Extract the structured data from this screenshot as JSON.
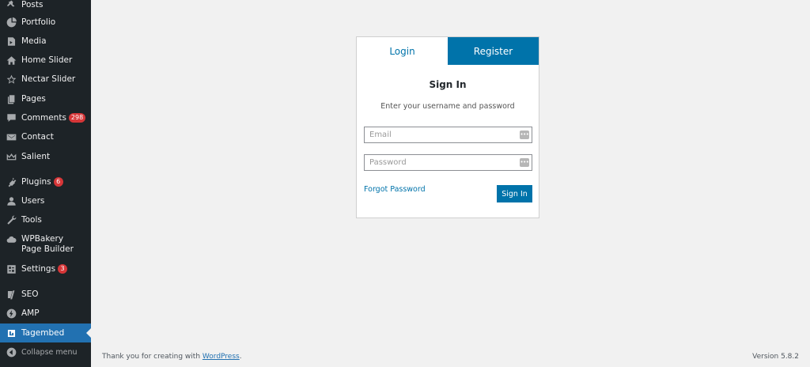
{
  "sidebar": {
    "items": [
      {
        "label": "Posts",
        "icon": "pin-icon"
      },
      {
        "label": "Portfolio",
        "icon": "portfolio-icon"
      },
      {
        "label": "Media",
        "icon": "media-icon"
      },
      {
        "label": "Home Slider",
        "icon": "home-icon"
      },
      {
        "label": "Nectar Slider",
        "icon": "star-icon"
      },
      {
        "label": "Pages",
        "icon": "pages-icon"
      },
      {
        "label": "Comments",
        "icon": "comment-icon",
        "badge": "298"
      },
      {
        "label": "Contact",
        "icon": "mail-icon"
      },
      {
        "label": "Salient",
        "icon": "crown-icon"
      },
      {
        "label": "Plugins",
        "icon": "plugin-icon",
        "badge": "6"
      },
      {
        "label": "Users",
        "icon": "user-icon"
      },
      {
        "label": "Tools",
        "icon": "wrench-icon"
      },
      {
        "label": "WPBakery Page Builder",
        "icon": "cloud-icon"
      },
      {
        "label": "Settings",
        "icon": "settings-icon",
        "badge": "3"
      },
      {
        "label": "SEO",
        "icon": "seo-icon"
      },
      {
        "label": "AMP",
        "icon": "amp-icon"
      },
      {
        "label": "Tagembed",
        "icon": "tagembed-icon",
        "active": true
      },
      {
        "label": "Collapse menu",
        "icon": "collapse-icon"
      }
    ]
  },
  "login": {
    "tab_login": "Login",
    "tab_register": "Register",
    "title": "Sign In",
    "subtitle": "Enter your username and password",
    "email_placeholder": "Email",
    "password_placeholder": "Password",
    "forgot_label": "Forgot Password",
    "signin_label": "Sign In"
  },
  "footer": {
    "thanks_prefix": "Thank you for creating with ",
    "wordpress_link": "WordPress",
    "thanks_suffix": ".",
    "version": "Version 5.8.2"
  },
  "colors": {
    "sidebar_bg": "#1d2327",
    "accent": "#0073aa",
    "active_menu": "#2271b1",
    "badge": "#d63638",
    "page_bg": "#f1f1f1"
  }
}
